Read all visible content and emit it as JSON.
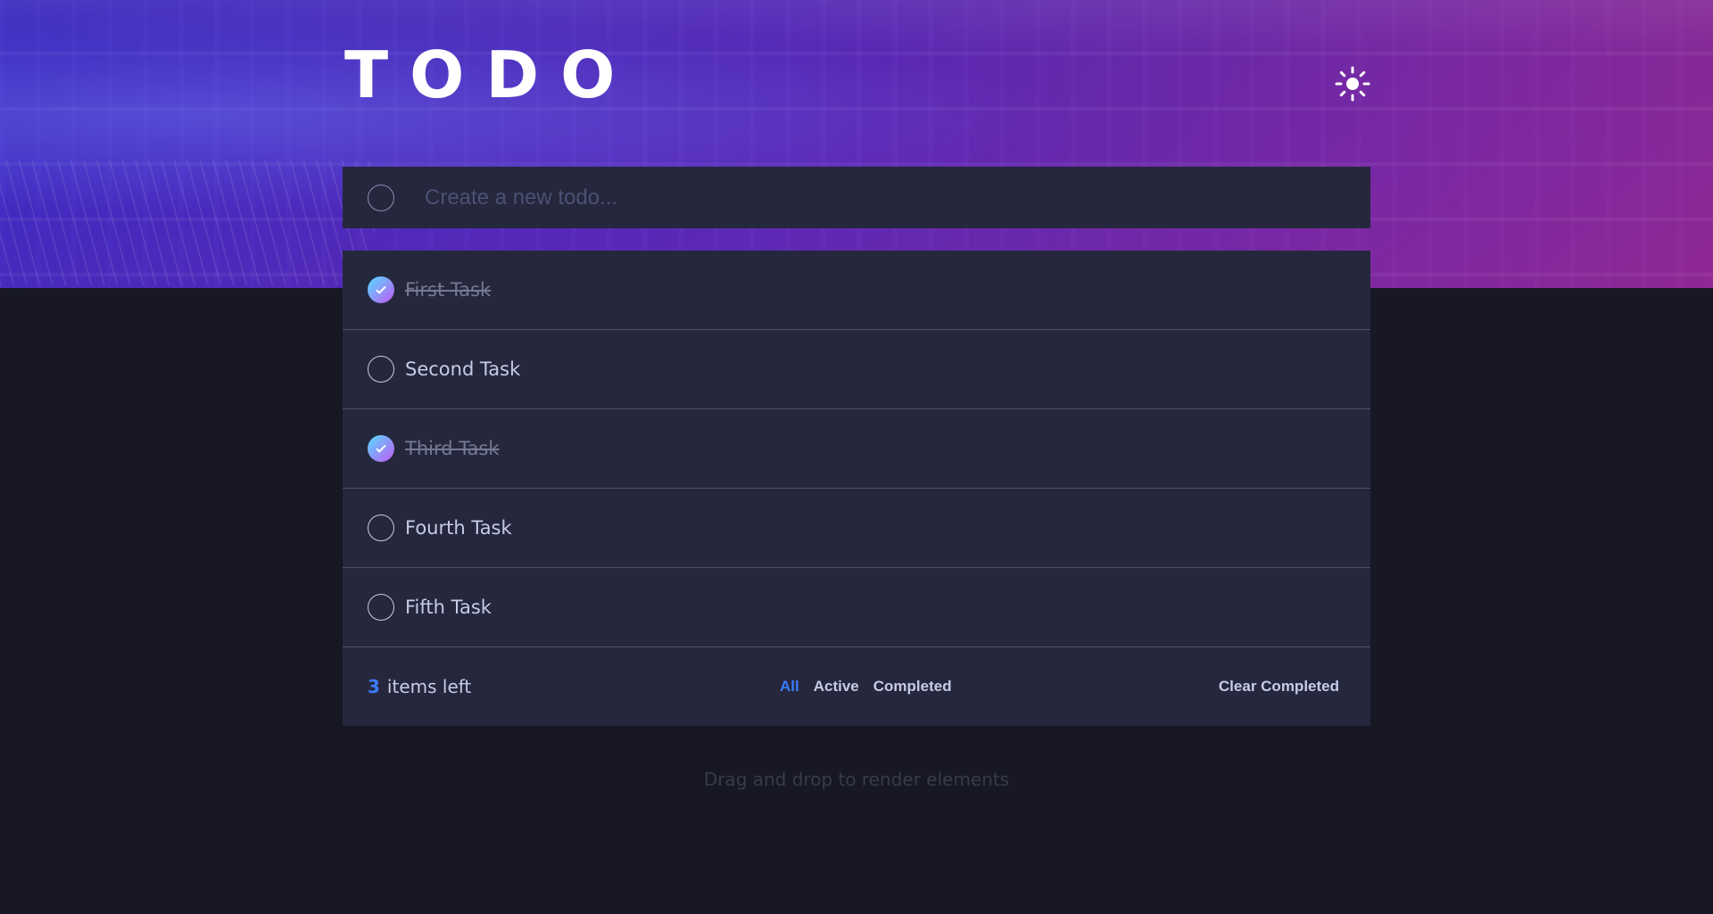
{
  "header": {
    "title": "TODO",
    "theme_icon": "sun-icon"
  },
  "new_todo": {
    "placeholder": "Create a new todo...",
    "value": ""
  },
  "todos": [
    {
      "text": "First Task",
      "completed": true
    },
    {
      "text": "Second Task",
      "completed": false
    },
    {
      "text": "Third Task",
      "completed": true
    },
    {
      "text": "Fourth Task",
      "completed": false
    },
    {
      "text": "Fifth Task",
      "completed": false
    }
  ],
  "footer": {
    "count": "3",
    "items_left_label": "items left",
    "filters": [
      "All",
      "Active",
      "Completed"
    ],
    "active_filter": "All",
    "clear_label": "Clear Completed"
  },
  "hint": "Drag and drop to render elements",
  "colors": {
    "background": "#171823",
    "card": "#25273d",
    "accent": "#3a7cfd",
    "check_gradient_start": "#55ddff",
    "check_gradient_end": "#c058f3",
    "text": "#c8cbe7",
    "text_done": "#767992"
  }
}
